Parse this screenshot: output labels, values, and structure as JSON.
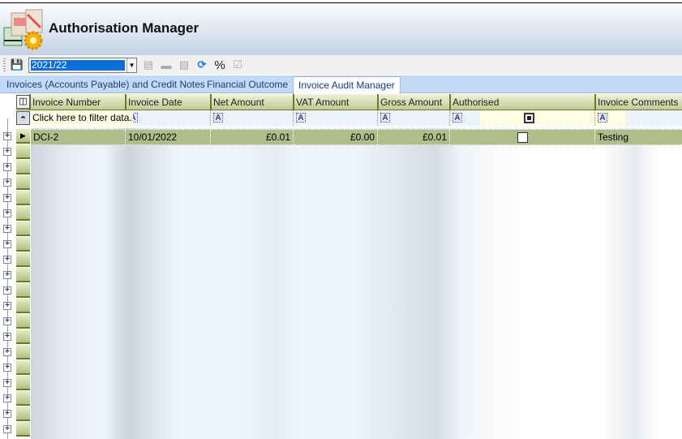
{
  "app": {
    "title": "Authorisation Manager"
  },
  "toolbar": {
    "year": "2021/22",
    "percent_label": "%",
    "icons": [
      "save-icon",
      "document-icon",
      "eraser-icon",
      "report-icon",
      "refresh-icon",
      "percent-icon",
      "clipboard-icon"
    ]
  },
  "tabs": [
    {
      "label": "Invoices (Accounts Payable) and Credit Notes",
      "active": false
    },
    {
      "label": "Financial Outcome",
      "active": false
    },
    {
      "label": "Invoice Audit Manager",
      "active": true
    }
  ],
  "grid": {
    "columns": [
      "Invoice Number",
      "Invoice Date",
      "Net Amount",
      "VAT Amount",
      "Gross Amount",
      "Authorised",
      "Invoice Comments"
    ],
    "filter_placeholder": "Click here to filter data...",
    "filter_icon_label": "A",
    "rows": [
      {
        "invoice_number": "DCI-2",
        "invoice_date": "10/01/2022",
        "net": "£0.01",
        "vat": "£0.00",
        "gross": "£0.01",
        "authorised": false,
        "comments": "Testing"
      }
    ]
  },
  "colors": {
    "header_green": "#bfca95",
    "row_selected": "#b0bd8a",
    "tab_bar": "#c2daf7",
    "filter_row": "#fffde3"
  }
}
